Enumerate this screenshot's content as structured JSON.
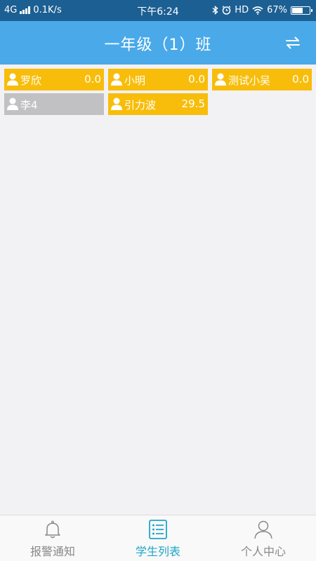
{
  "status_bar": {
    "network": "4G",
    "speed": "0.1K/s",
    "time": "下午6:24",
    "hd": "HD",
    "battery": "67%",
    "battery_level": 0.67
  },
  "header": {
    "title": "一年级（1）班",
    "switch_icon": "swap-arrows-icon"
  },
  "students": [
    {
      "name": "罗欣",
      "score": "0.0",
      "status": "active",
      "color": "#f8bd0a"
    },
    {
      "name": "小明",
      "score": "0.0",
      "status": "active",
      "color": "#f8bd0a"
    },
    {
      "name": "测试小吴",
      "score": "0.0",
      "status": "active",
      "color": "#f8bd0a"
    },
    {
      "name": "李4",
      "score": "",
      "status": "inactive",
      "color": "#c1c0c2"
    },
    {
      "name": "引力波",
      "score": "29.5",
      "status": "active",
      "color": "#f8bd0a"
    }
  ],
  "tabbar": {
    "tabs": [
      {
        "label": "报警通知",
        "icon": "bell-icon",
        "active": false
      },
      {
        "label": "学生列表",
        "icon": "list-icon",
        "active": true
      },
      {
        "label": "个人中心",
        "icon": "user-icon",
        "active": false
      }
    ],
    "active_color": "#1fa6c8"
  }
}
